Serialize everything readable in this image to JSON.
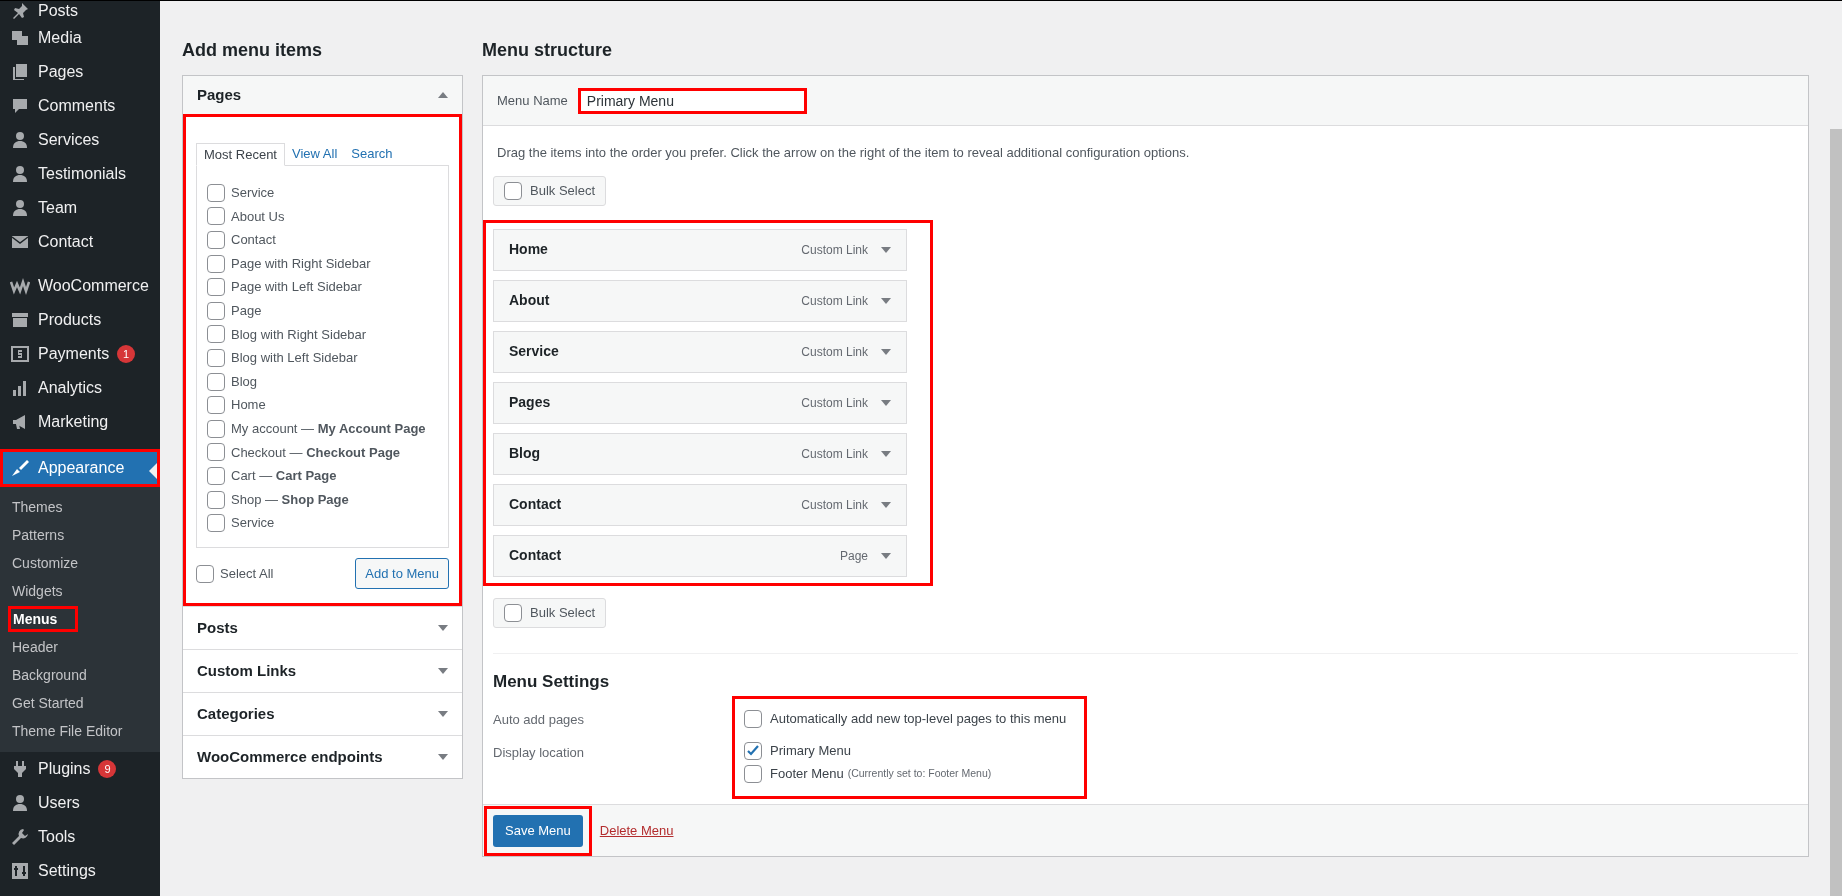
{
  "sidebar": {
    "groups": [
      {
        "items": [
          {
            "label": "Posts",
            "selected": false,
            "highlighted": false
          },
          {
            "label": "Media",
            "selected": false,
            "highlighted": false
          },
          {
            "label": "Pages",
            "selected": false,
            "highlighted": false
          },
          {
            "label": "Comments",
            "selected": false,
            "highlighted": false
          },
          {
            "label": "Services",
            "selected": false,
            "highlighted": false
          },
          {
            "label": "Testimonials",
            "selected": false,
            "highlighted": false
          },
          {
            "label": "Team",
            "selected": false,
            "highlighted": false
          },
          {
            "label": "Contact",
            "selected": false,
            "highlighted": false
          }
        ]
      },
      {
        "items": [
          {
            "label": "WooCommerce",
            "selected": false,
            "highlighted": false
          },
          {
            "label": "Products",
            "selected": false,
            "highlighted": false
          },
          {
            "label": "Payments",
            "badge": "1",
            "selected": false,
            "highlighted": false
          },
          {
            "label": "Analytics",
            "selected": false,
            "highlighted": false
          },
          {
            "label": "Marketing",
            "selected": false,
            "highlighted": false
          }
        ]
      },
      {
        "items": [
          {
            "label": "Appearance",
            "selected": true,
            "highlighted": true,
            "submenu": [
              {
                "label": "Themes",
                "selected": false,
                "highlighted": false
              },
              {
                "label": "Patterns",
                "selected": false,
                "highlighted": false
              },
              {
                "label": "Customize",
                "selected": false,
                "highlighted": false
              },
              {
                "label": "Widgets",
                "selected": false,
                "highlighted": false
              },
              {
                "label": "Menus",
                "selected": true,
                "highlighted": true
              },
              {
                "label": "Header",
                "selected": false,
                "highlighted": false
              },
              {
                "label": "Background",
                "selected": false,
                "highlighted": false
              },
              {
                "label": "Get Started",
                "selected": false,
                "highlighted": false
              },
              {
                "label": "Theme File Editor",
                "selected": false,
                "highlighted": false
              }
            ]
          },
          {
            "label": "Plugins",
            "badge": "9",
            "selected": false,
            "highlighted": false
          },
          {
            "label": "Users",
            "selected": false,
            "highlighted": false
          },
          {
            "label": "Tools",
            "selected": false,
            "highlighted": false
          },
          {
            "label": "Settings",
            "selected": false,
            "highlighted": false
          }
        ]
      }
    ]
  },
  "add_menu_items": {
    "heading": "Add menu items",
    "sections": [
      {
        "title": "Pages",
        "expanded": true,
        "highlighted": true,
        "tabs": [
          {
            "label": "Most Recent",
            "selected": true
          },
          {
            "label": "View All",
            "selected": false
          },
          {
            "label": "Search",
            "selected": false
          }
        ],
        "items": [
          {
            "label": "Service",
            "checked": false
          },
          {
            "label": "About Us",
            "checked": false
          },
          {
            "label": "Contact",
            "checked": false
          },
          {
            "label": "Page with Right Sidebar",
            "checked": false
          },
          {
            "label": "Page with Left Sidebar",
            "checked": false
          },
          {
            "label": "Page",
            "checked": false
          },
          {
            "label": "Blog with Right Sidebar",
            "checked": false
          },
          {
            "label": "Blog with Left Sidebar",
            "checked": false
          },
          {
            "label": "Blog",
            "checked": false
          },
          {
            "label": "Home",
            "checked": false
          },
          {
            "label": "My account — **My Account Page**",
            "checked": false
          },
          {
            "label": "Checkout — **Checkout Page**",
            "checked": false
          },
          {
            "label": "Cart — **Cart Page**",
            "checked": false
          },
          {
            "label": "Shop — **Shop Page**",
            "checked": false
          },
          {
            "label": "Service",
            "checked": false
          }
        ],
        "select_all": {
          "label": "Select All",
          "checked": false
        },
        "add_button": "Add to Menu"
      },
      {
        "title": "Posts",
        "expanded": false,
        "highlighted": false
      },
      {
        "title": "Custom Links",
        "expanded": false,
        "highlighted": false
      },
      {
        "title": "Categories",
        "expanded": false,
        "highlighted": false
      },
      {
        "title": "WooCommerce endpoints",
        "expanded": false,
        "highlighted": false
      }
    ]
  },
  "menu_structure": {
    "heading": "Menu structure",
    "menu_name": {
      "label": "Menu Name",
      "value": "Primary Menu",
      "highlighted": true
    },
    "instructions": "Drag the items into the order you prefer. Click the arrow on the right of the item to reveal additional configuration options.",
    "bulk_select_top": {
      "label": "Bulk Select",
      "checked": false
    },
    "items_highlighted": true,
    "items": [
      {
        "title": "Home",
        "type": "Custom Link"
      },
      {
        "title": "About",
        "type": "Custom Link"
      },
      {
        "title": "Service",
        "type": "Custom Link"
      },
      {
        "title": "Pages",
        "type": "Custom Link"
      },
      {
        "title": "Blog",
        "type": "Custom Link"
      },
      {
        "title": "Contact",
        "type": "Custom Link"
      },
      {
        "title": "Contact",
        "type": "Page"
      }
    ],
    "bulk_select_bottom": {
      "label": "Bulk Select",
      "checked": false
    },
    "settings": {
      "heading": "Menu Settings",
      "highlighted": true,
      "auto_add": {
        "label": "Auto add pages",
        "option": {
          "label": "Automatically add new top-level pages to this menu",
          "checked": false
        }
      },
      "display_location": {
        "label": "Display location",
        "options": [
          {
            "label": "Primary Menu",
            "checked": true
          },
          {
            "label": "Footer Menu",
            "note": "(Currently set to: Footer Menu)",
            "checked": false
          }
        ]
      }
    },
    "save_button": {
      "label": "Save Menu",
      "highlighted": true
    },
    "delete_link": "Delete Menu"
  }
}
